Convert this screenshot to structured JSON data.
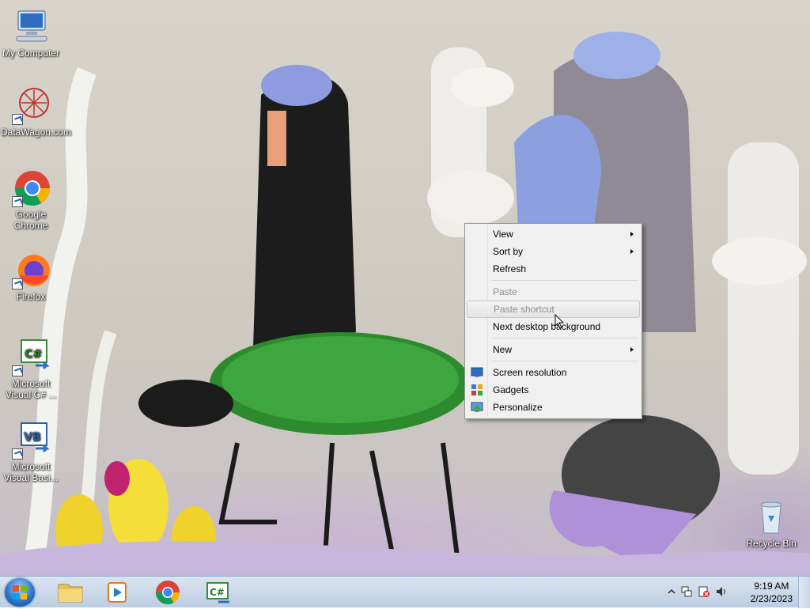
{
  "desktop_icons": [
    {
      "label": "My Computer",
      "icon": "computer-icon"
    },
    {
      "label": "DataWagon.com",
      "icon": "datawagon-icon"
    },
    {
      "label": "Google Chrome",
      "icon": "chrome-icon"
    },
    {
      "label": "Firefox",
      "icon": "firefox-icon"
    },
    {
      "label": "Microsoft Visual C# ...",
      "icon": "visual-csharp-icon"
    },
    {
      "label": "Microsoft Visual Basi...",
      "icon": "visual-basic-icon"
    },
    {
      "label": "Recycle Bin",
      "icon": "recycle-bin-icon"
    }
  ],
  "context_menu": {
    "items": [
      {
        "label": "View",
        "submenu": true
      },
      {
        "label": "Sort by",
        "submenu": true
      },
      {
        "label": "Refresh"
      },
      {
        "label": "Paste",
        "disabled": true
      },
      {
        "label": "Paste shortcut",
        "disabled": true,
        "highlighted": true
      },
      {
        "label": "Next desktop background"
      },
      {
        "label": "New",
        "submenu": true
      },
      {
        "label": "Screen resolution",
        "icon": "screen-resolution-icon"
      },
      {
        "label": "Gadgets",
        "icon": "gadgets-icon"
      },
      {
        "label": "Personalize",
        "icon": "personalize-icon"
      }
    ]
  },
  "taskbar": {
    "start_icon": "windows-start-icon",
    "pinned": [
      "file-explorer-icon",
      "media-player-icon",
      "chrome-icon",
      "visual-csharp-icon"
    ]
  },
  "tray": {
    "icons": [
      "show-hidden-icons-arrow",
      "network-icon",
      "action-center-icon",
      "volume-icon"
    ],
    "time": "9:19 AM",
    "date": "2/23/2023"
  },
  "colors": {
    "taskbar": "#c9d8ea",
    "menu_bg": "#f0f0f0",
    "disabled_text": "#8d8d8d"
  }
}
